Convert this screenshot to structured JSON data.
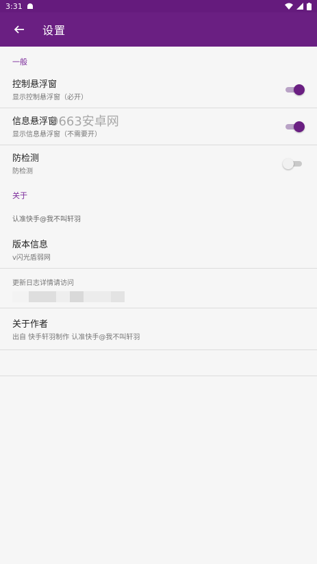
{
  "status_bar": {
    "time": "3:31"
  },
  "app_bar": {
    "title": "设置"
  },
  "watermark": "9663安卓网",
  "sections": {
    "general": "一般",
    "about": "关于"
  },
  "settings": {
    "control_float": {
      "title": "控制悬浮窗",
      "subtitle": "显示控制悬浮窗（必开）",
      "enabled": true
    },
    "info_float": {
      "title": "信息悬浮窗",
      "subtitle": "显示信息悬浮窗（不需要开）",
      "enabled": true
    },
    "anti_detect": {
      "title": "防检测",
      "subtitle": "防检测",
      "enabled": false
    }
  },
  "about": {
    "note": "认准快手@我不叫轩羽",
    "version": {
      "title": "版本信息",
      "subtitle": "v闪光盾弱网"
    },
    "changelog": {
      "title": "更新日志详情请访问"
    },
    "author": {
      "title": "关于作者",
      "subtitle": "出自 快手轩羽制作 认准快手@我不叫轩羽"
    }
  },
  "colors": {
    "primary": "#6a1f82",
    "accent": "#7b2a9a"
  }
}
